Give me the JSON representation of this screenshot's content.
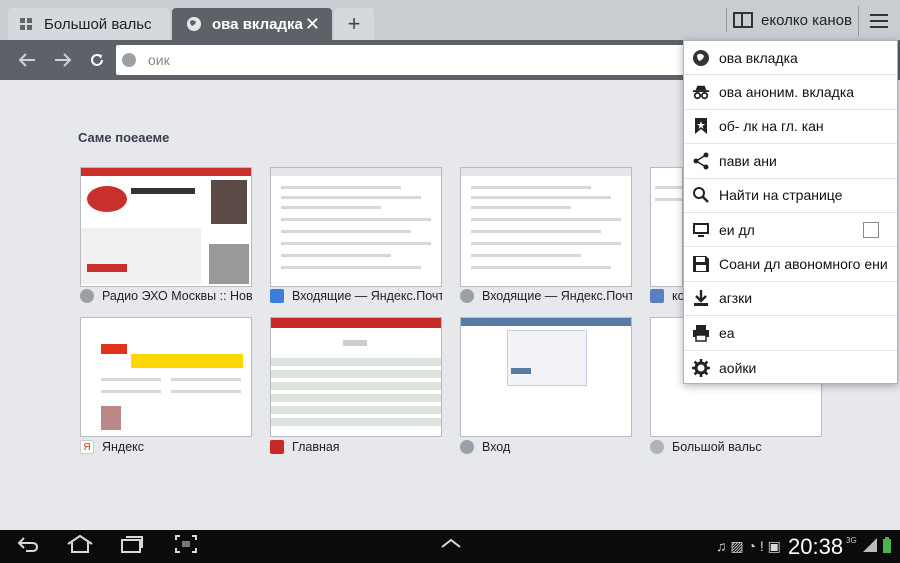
{
  "tabs": [
    {
      "label": "Большой вальс",
      "active": false
    },
    {
      "label": "ова вкладка",
      "active": true
    }
  ],
  "new_tab_label": "+",
  "bookmarks_label": "еколко канов",
  "omnibox": {
    "placeholder": "оик"
  },
  "section_title": "Саме поеаеме",
  "thumbnails": [
    {
      "title": "Радио ЭХО Москвы :: Нов..."
    },
    {
      "title": "Входящие — Яндекс.Почта"
    },
    {
      "title": "Входящие — Яндекс.Почта"
    },
    {
      "title": "ко"
    },
    {
      "title": "Яндекс"
    },
    {
      "title": "Главная"
    },
    {
      "title": "Вход"
    },
    {
      "title": "Большой вальс"
    }
  ],
  "menu": {
    "items": [
      {
        "label": "ова вкладка",
        "icon": "globe-plus-icon"
      },
      {
        "label": "ова аноним. вкладка",
        "icon": "incognito-icon"
      },
      {
        "label": "об- лк на гл. кан",
        "icon": "bookmark-add-icon"
      },
      {
        "label": "пави ани",
        "icon": "share-icon"
      },
      {
        "label": "Найти на странице",
        "icon": "search-icon"
      },
      {
        "label": "еи дл",
        "icon": "monitor-icon",
        "checkbox": false
      },
      {
        "label": "Соани дл авономного ени",
        "icon": "save-icon"
      },
      {
        "label": "агзки",
        "icon": "download-icon"
      },
      {
        "label": "еа",
        "icon": "print-icon"
      },
      {
        "label": "аойки",
        "icon": "settings-icon"
      }
    ]
  },
  "status_bar": {
    "time": "20:38",
    "network": "3G"
  },
  "colors": {
    "toolbar": "#5d6268",
    "tabstrip": "#c9ccd1",
    "content_bg": "#e6e8eb",
    "section_title": "#35414f"
  }
}
